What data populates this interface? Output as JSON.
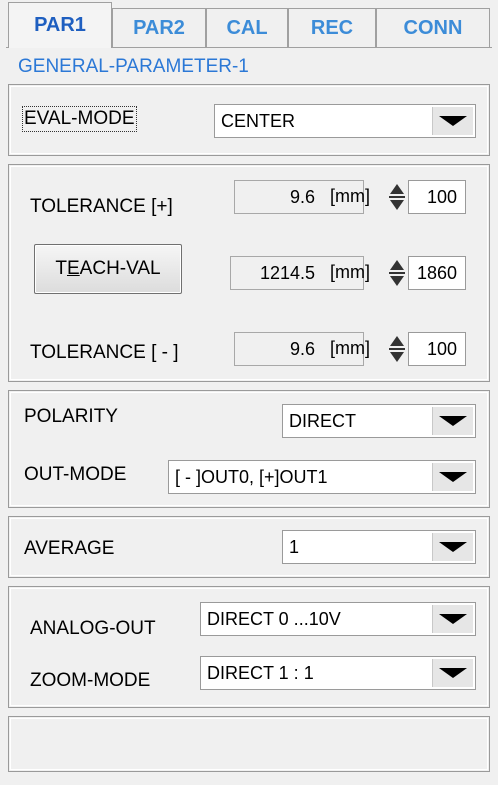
{
  "tabs": [
    {
      "label": "PAR1",
      "active": true
    },
    {
      "label": "PAR2",
      "active": false
    },
    {
      "label": "CAL",
      "active": false
    },
    {
      "label": "REC",
      "active": false
    },
    {
      "label": "CONN",
      "active": false
    }
  ],
  "section_title": "GENERAL-PARAMETER-1",
  "eval_mode": {
    "label": "EVAL-MODE",
    "value": "CENTER"
  },
  "tolerance_plus": {
    "label": "TOLERANCE [+]",
    "value": "9.6",
    "unit": "[mm]",
    "raw": "100"
  },
  "teach": {
    "button": "TEACH-VAL",
    "value": "1214.5",
    "unit": "[mm]",
    "raw": "1860"
  },
  "tolerance_minus": {
    "label": "TOLERANCE [ - ]",
    "value": "9.6",
    "unit": "[mm]",
    "raw": "100"
  },
  "polarity": {
    "label": "POLARITY",
    "value": "DIRECT"
  },
  "out_mode": {
    "label": "OUT-MODE",
    "value": "[ - ]OUT0, [+]OUT1"
  },
  "average": {
    "label": "AVERAGE",
    "value": "1"
  },
  "analog_out": {
    "label": "ANALOG-OUT",
    "value": "DIRECT 0 ...10V"
  },
  "zoom_mode": {
    "label": "ZOOM-MODE",
    "value": "DIRECT 1 : 1"
  },
  "status_text": ""
}
